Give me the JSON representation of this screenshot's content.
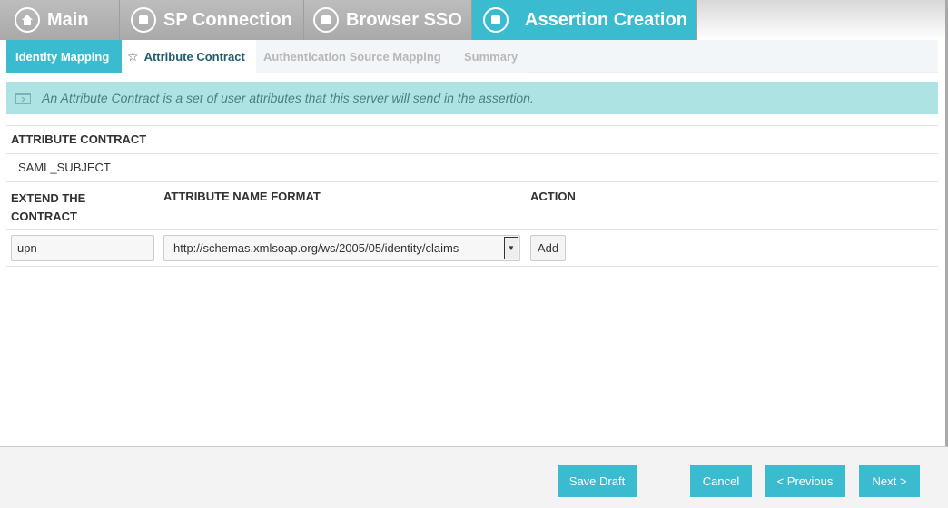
{
  "top_tabs": [
    {
      "label": "Main",
      "icon": "home-icon"
    },
    {
      "label": "SP Connection",
      "icon": "stop-icon"
    },
    {
      "label": "Browser SSO",
      "icon": "stop-icon"
    },
    {
      "label": "Assertion Creation",
      "icon": "stop-icon"
    }
  ],
  "sub_tabs": [
    {
      "label": "Identity Mapping"
    },
    {
      "label": "Attribute Contract"
    },
    {
      "label": "Authentication Source Mapping"
    },
    {
      "label": "Summary"
    }
  ],
  "info": {
    "text": "An Attribute Contract is a set of user attributes that this server will send in the assertion."
  },
  "contract": {
    "heading": "ATTRIBUTE CONTRACT",
    "items": [
      "SAML_SUBJECT"
    ]
  },
  "extend": {
    "col1_line1": "EXTEND THE",
    "col1_line2": "CONTRACT",
    "col2": "ATTRIBUTE NAME FORMAT",
    "col3": "ACTION",
    "name_value": "upn",
    "format_value": "http://schemas.xmlsoap.org/ws/2005/05/identity/claims",
    "add_label": "Add"
  },
  "footer": {
    "save_draft": "Save Draft",
    "cancel": "Cancel",
    "previous": "< Previous",
    "next": "Next >"
  },
  "colors": {
    "accent": "#3bbbd0",
    "info_bg": "#aee3e3"
  }
}
